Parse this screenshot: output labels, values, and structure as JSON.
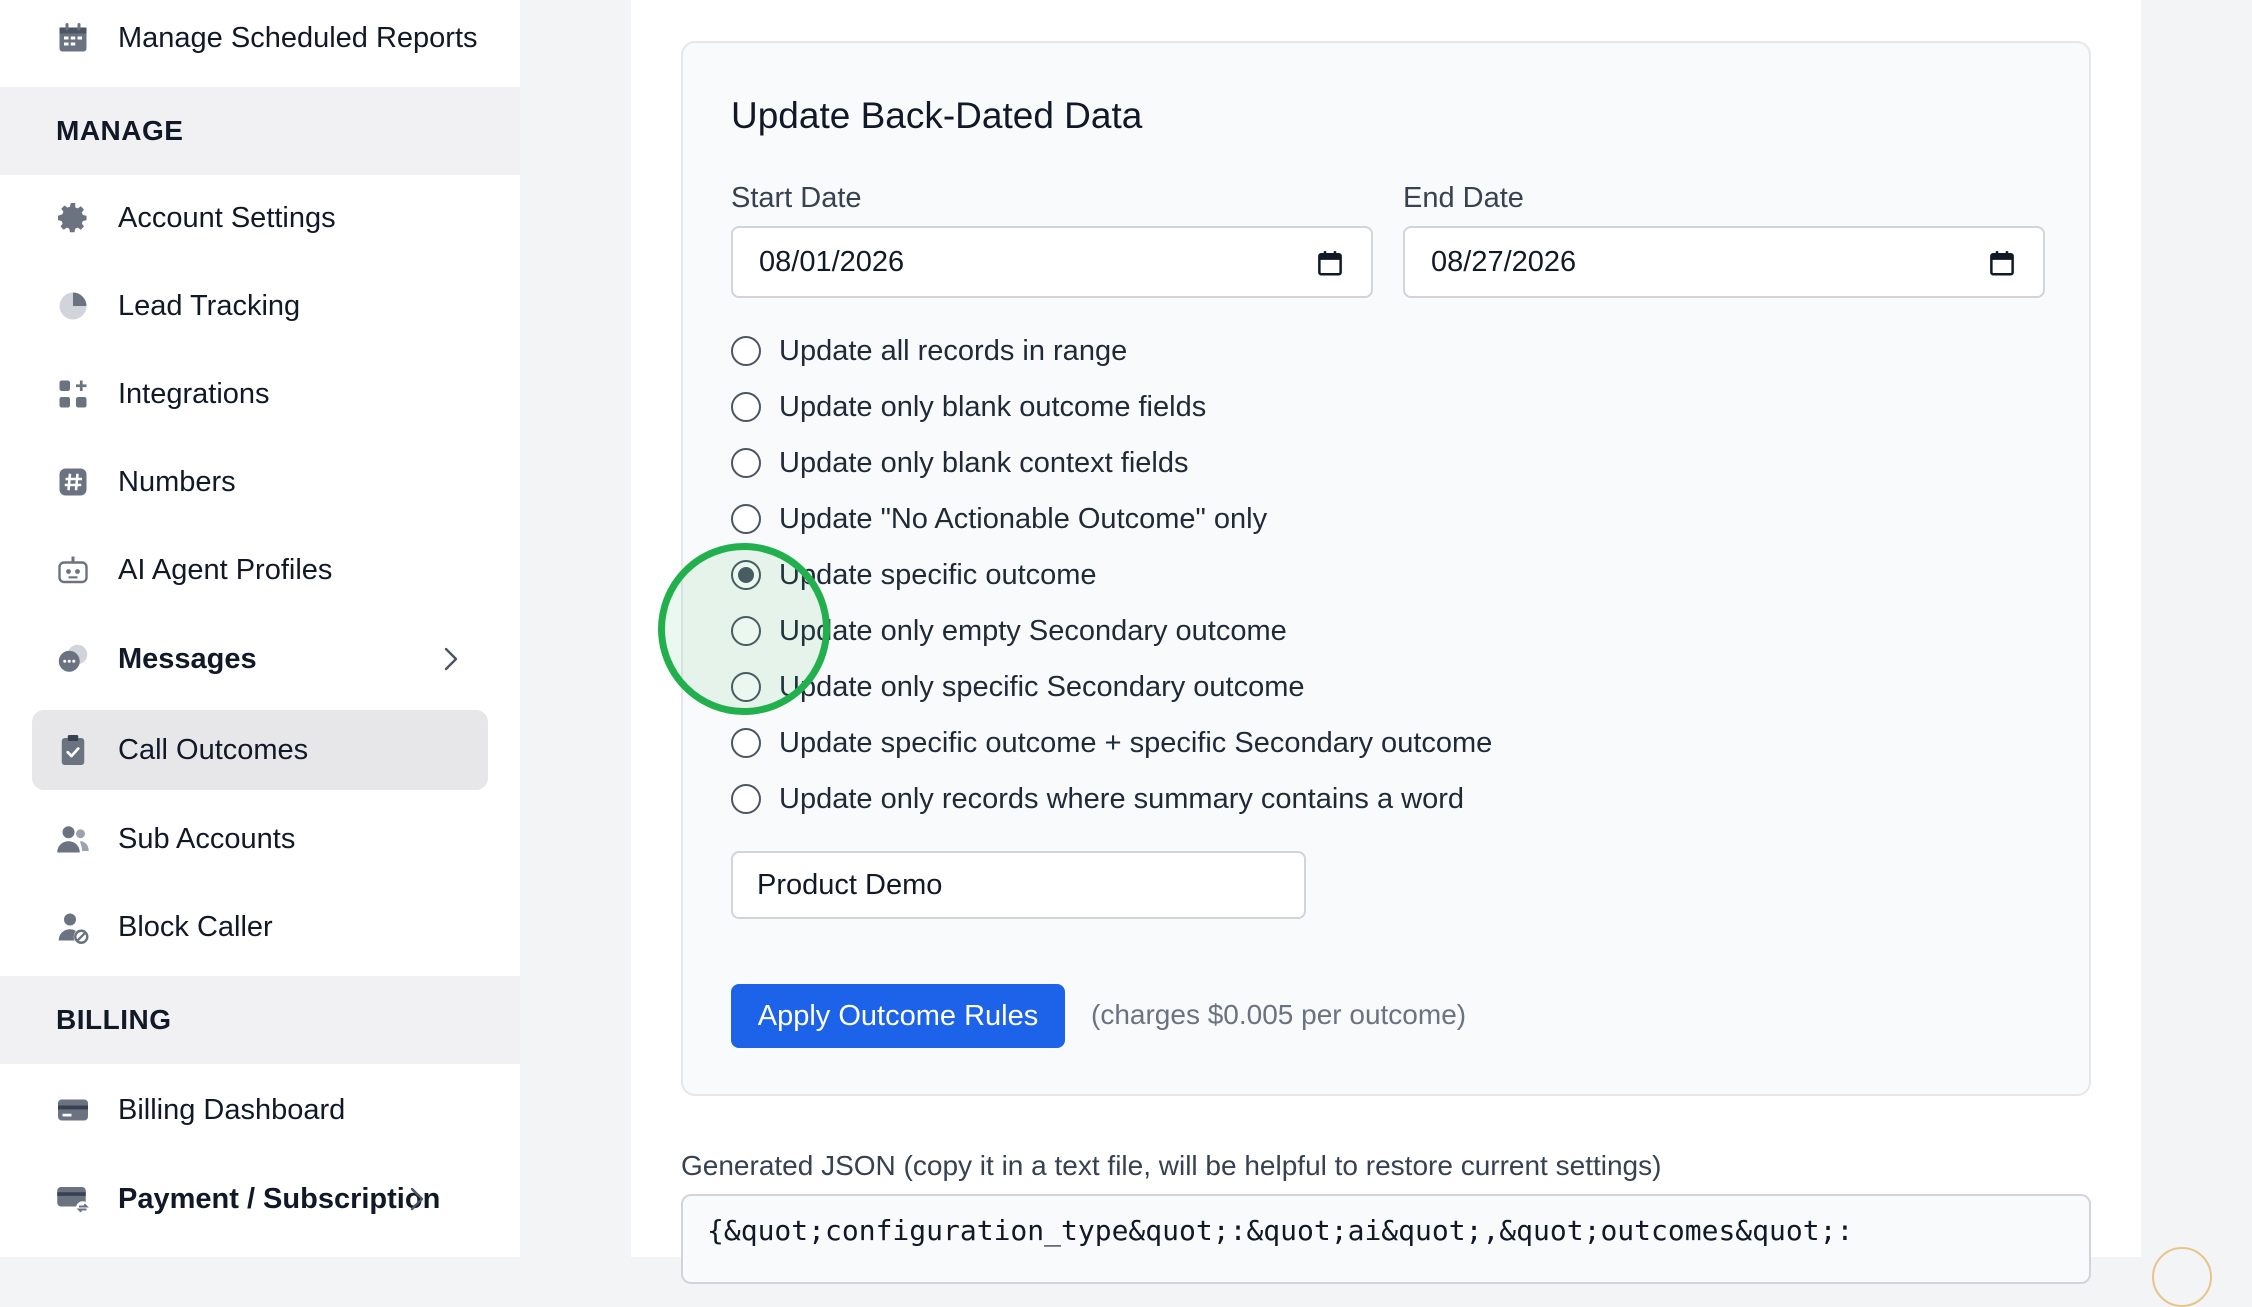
{
  "sidebar": {
    "items_top": [
      {
        "label": "Manage Scheduled Reports",
        "icon": "calendar-icon"
      }
    ],
    "manage_header": "MANAGE",
    "manage_items": [
      {
        "label": "Account Settings",
        "icon": "gear-icon"
      },
      {
        "label": "Lead Tracking",
        "icon": "pie-chart-icon"
      },
      {
        "label": "Integrations",
        "icon": "grid-plus-icon"
      },
      {
        "label": "Numbers",
        "icon": "hash-icon"
      },
      {
        "label": "AI Agent Profiles",
        "icon": "robot-icon"
      },
      {
        "label": "Messages",
        "icon": "chat-bubbles-icon"
      },
      {
        "label": "Call Outcomes",
        "icon": "clipboard-check-icon"
      },
      {
        "label": "Sub Accounts",
        "icon": "users-icon"
      },
      {
        "label": "Block Caller",
        "icon": "user-block-icon"
      }
    ],
    "billing_header": "BILLING",
    "billing_items": [
      {
        "label": "Billing Dashboard",
        "icon": "credit-card-icon"
      },
      {
        "label": "Payment / Subscription",
        "icon": "card-exchange-icon"
      }
    ],
    "active_item": "Call Outcomes"
  },
  "card": {
    "title": "Update Back-Dated Data",
    "start_date_label": "Start Date",
    "start_date_value": "08/01/2026",
    "end_date_label": "End Date",
    "end_date_value": "08/27/2026",
    "options": [
      {
        "label": "Update all records in range",
        "checked": false
      },
      {
        "label": "Update only blank outcome fields",
        "checked": false
      },
      {
        "label": "Update only blank context fields",
        "checked": false
      },
      {
        "label": "Update \"No Actionable Outcome\" only",
        "checked": false
      },
      {
        "label": "Update specific outcome",
        "checked": true
      },
      {
        "label": "Update only empty Secondary outcome",
        "checked": false
      },
      {
        "label": "Update only specific Secondary outcome",
        "checked": false
      },
      {
        "label": "Update specific outcome + specific Secondary outcome",
        "checked": false
      },
      {
        "label": "Update only records where summary contains a word",
        "checked": false
      }
    ],
    "outcome_input_value": "Product Demo",
    "apply_button": "Apply Outcome Rules",
    "charges_note": "(charges $0.005 per outcome)"
  },
  "json_section": {
    "label": "Generated JSON (copy it in a text file, will be helpful to restore current settings)",
    "content": "{&quot;configuration_type&quot;:&quot;ai&quot;,&quot;outcomes&quot;:"
  },
  "colors": {
    "accent": "#1d63ea",
    "highlight_ring": "#22b04f",
    "active_nav_bg": "#e7e7ea"
  }
}
